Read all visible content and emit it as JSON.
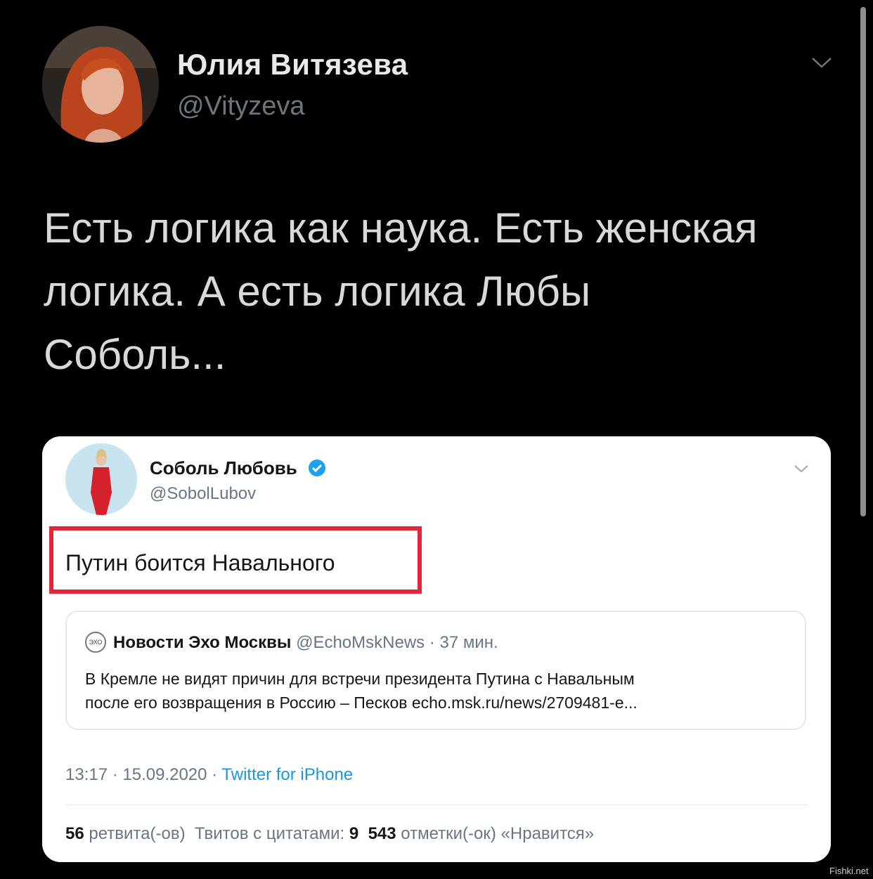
{
  "author": {
    "name": "Юлия Витязева",
    "handle": "@Vityzeva"
  },
  "tweet": {
    "lines": [
      "Есть логика как наука. Есть женская",
      "логика. А есть логика Любы",
      "Соболь..."
    ]
  },
  "embedded": {
    "name": "Соболь Любовь",
    "handle": "@SobolLubov",
    "text": "Путин боится Навального",
    "quote": {
      "icon_label": "ЭХО",
      "name": "Новости Эхо Москвы",
      "handle": "@EchoMskNews",
      "time": "· 37 мин.",
      "body_lines": [
        "В Кремле не видят причин для встречи президента Путина с Навальным",
        "после его возвращения в Россию – Песков echo.msk.ru/news/2709481-e..."
      ]
    },
    "meta": {
      "datetime": "13:17 · 15.09.2020 ·",
      "source": "Twitter for iPhone"
    },
    "stats": {
      "retweets_count": "56",
      "retweets_label": "ретвита(-ов)",
      "quotes_label": "Твитов с цитатами:",
      "quotes_count": "9",
      "likes_count": "543",
      "likes_label": "отметки(-ок) «Нравится»"
    }
  },
  "watermark": "Fishki.net",
  "colors": {
    "background": "#000000",
    "highlight_border": "#e02839",
    "verified_blue": "#1da1f2",
    "link_blue": "#1b95e0"
  },
  "icons": {
    "menu": "chevron-down-icon",
    "verified": "verified-badge-icon"
  }
}
